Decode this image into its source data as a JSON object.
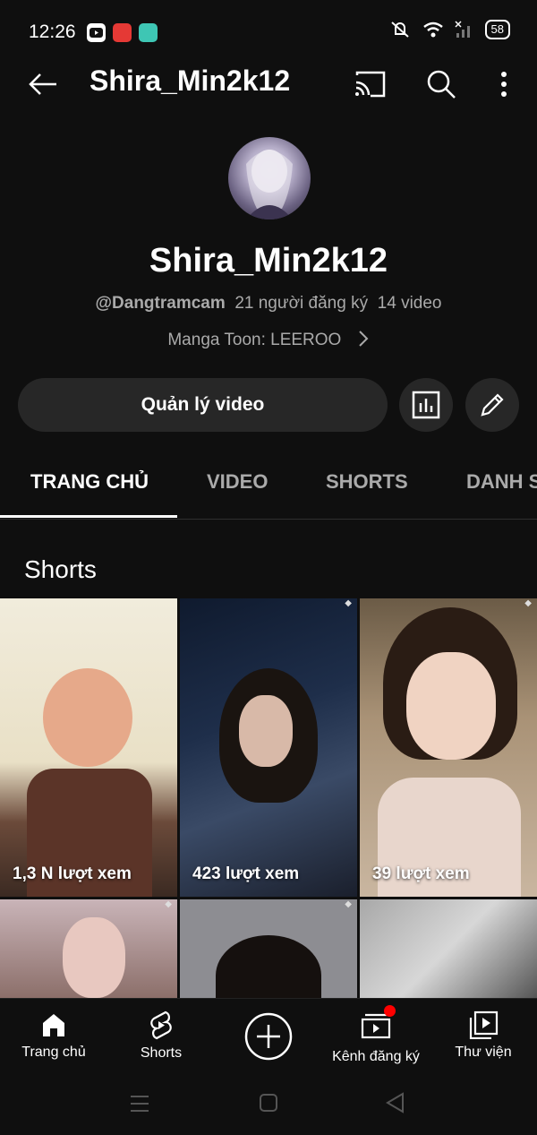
{
  "status_bar": {
    "time": "12:26",
    "battery": "58"
  },
  "top_bar": {
    "title": "Shira_Min2k12"
  },
  "channel": {
    "name": "Shira_Min2k12",
    "handle": "@Dangtramcam",
    "subscribers": "21 người đăng ký",
    "video_count": "14 video",
    "link": "Manga Toon: LEEROO"
  },
  "actions": {
    "manage_label": "Quản lý video"
  },
  "tabs": [
    {
      "label": "TRANG CHỦ",
      "active": true
    },
    {
      "label": "VIDEO",
      "active": false
    },
    {
      "label": "SHORTS",
      "active": false
    },
    {
      "label": "DANH S",
      "active": false
    }
  ],
  "shorts": {
    "title": "Shorts",
    "items": [
      {
        "views": "1,3 N lượt xem"
      },
      {
        "views": "423 lượt xem"
      },
      {
        "views": "39 lượt xem"
      }
    ]
  },
  "bottom_nav": [
    {
      "label": "Trang chủ",
      "icon": "home-icon"
    },
    {
      "label": "Shorts",
      "icon": "shorts-icon"
    },
    {
      "label": "",
      "icon": "create-icon"
    },
    {
      "label": "Kênh đăng ký",
      "icon": "subscriptions-icon"
    },
    {
      "label": "Thư viện",
      "icon": "library-icon"
    }
  ],
  "colors": {
    "background": "#0f0f0f",
    "button": "#272727",
    "muted_text": "#aaaaaa",
    "badge": "#ff0000"
  }
}
